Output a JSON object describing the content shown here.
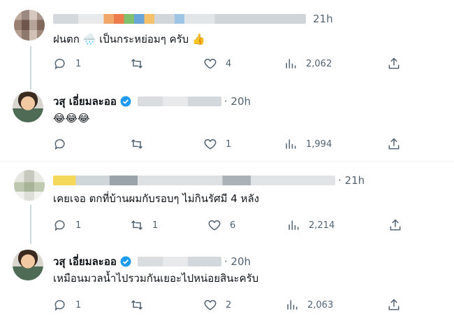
{
  "tweets": [
    {
      "time": "21h",
      "text": "ฝนตก 🌧️ เป็นกระหย่อมๆ ครับ 👍",
      "replies": "1",
      "reposts": "",
      "likes": "4",
      "views": "2,062"
    },
    {
      "name": "วสุ เอี่ยมละออ",
      "time": "· 20h",
      "text": "😂😂😂",
      "replies": "",
      "reposts": "",
      "likes": "1",
      "views": "1,994"
    },
    {
      "time": "· 21h",
      "text": "เคยเจอ ตกที่บ้านผมกับรอบๆ ไม่กินรัศมี 4 หลัง",
      "replies": "1",
      "reposts": "1",
      "likes": "6",
      "views": "2,214"
    },
    {
      "name": "วสุ เอี่ยมละออ",
      "time": "· 20h",
      "text": "เหมือนมวลน้ำไปรวมกันเยอะไปหน่อยสินะครับ",
      "replies": "1",
      "reposts": "",
      "likes": "2",
      "views": "2,063"
    }
  ],
  "icons": {
    "reply": "reply-icon",
    "repost": "repost-icon",
    "like": "like-icon",
    "views": "views-icon",
    "share": "share-icon",
    "verified": "verified-badge-icon"
  },
  "colors": {
    "verified": "#1d9bf0",
    "icon_gray": "#536471"
  }
}
